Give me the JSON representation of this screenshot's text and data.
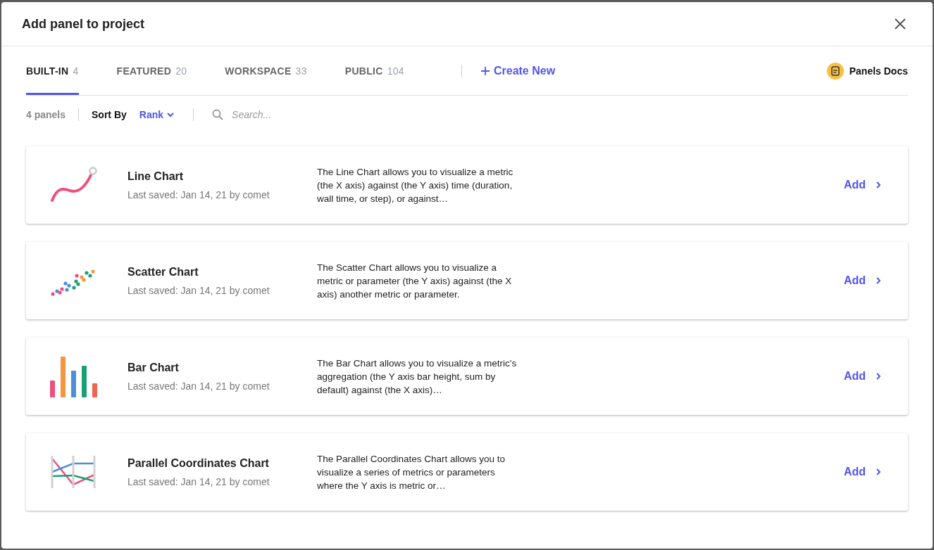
{
  "dialog": {
    "title": "Add panel to project"
  },
  "tabs": [
    {
      "label": "BUILT-IN",
      "count": "4",
      "selected": true
    },
    {
      "label": "FEATURED",
      "count": "20",
      "selected": false
    },
    {
      "label": "WORKSPACE",
      "count": "33",
      "selected": false
    },
    {
      "label": "PUBLIC",
      "count": "104",
      "selected": false
    }
  ],
  "create_new": "Create New",
  "docs_link": "Panels Docs",
  "toolbar": {
    "count": "4 panels",
    "sort_label": "Sort By",
    "sort_value": "Rank",
    "search": {
      "placeholder": "Search..."
    }
  },
  "panels": [
    {
      "kind": "line",
      "name": "Line Chart",
      "saved": "Last saved: Jan 14, 21 by comet",
      "description": "The Line Chart allows you to visualize a metric (the X axis) against (the Y axis) time (duration, wall time, or step), or against…",
      "action": "Add"
    },
    {
      "kind": "scatter",
      "name": "Scatter Chart",
      "saved": "Last saved: Jan 14, 21 by comet",
      "description": "The Scatter Chart allows you to visualize a metric or parameter (the Y axis) against (the X axis) another metric or parameter.",
      "action": "Add"
    },
    {
      "kind": "bar",
      "name": "Bar Chart",
      "saved": "Last saved: Jan 14, 21 by comet",
      "description": "The Bar Chart allows you to visualize a metric's aggregation (the Y axis bar height, sum by default) against (the X axis)…",
      "action": "Add"
    },
    {
      "kind": "parallel",
      "name": "Parallel Coordinates Chart",
      "saved": "Last saved: Jan 14, 21 by comet",
      "description": "The Parallel Coordinates Chart allows you to visualize a series of metrics or parameters where the Y axis is metric or…",
      "action": "Add"
    }
  ]
}
